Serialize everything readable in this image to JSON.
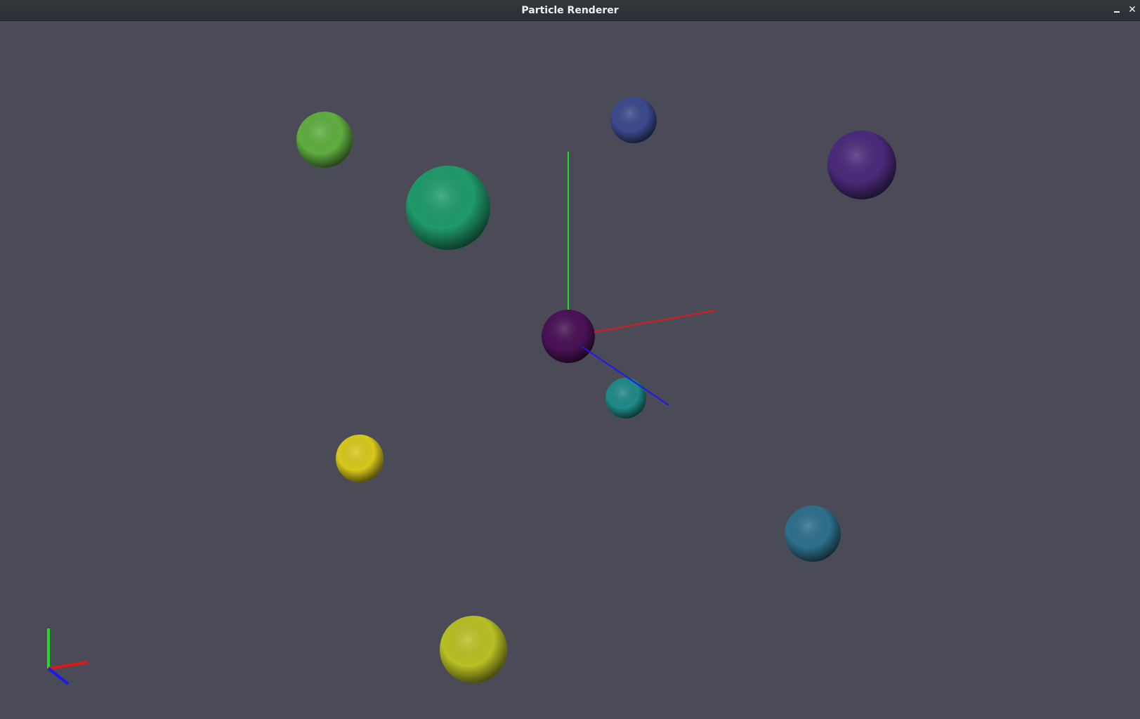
{
  "window": {
    "title": "Particle Renderer",
    "minimize_icon": "minimize-icon",
    "close_icon": "close-icon",
    "close_glyph": "✕"
  },
  "scene": {
    "background": "#4b4b57",
    "axis_colors": {
      "x": "#e01818",
      "y": "#22dd22",
      "z": "#1a1aee"
    },
    "particles": [
      {
        "name": "particle-green-light",
        "color": "#5fae40"
      },
      {
        "name": "particle-blue-small",
        "color": "#3a4a8c"
      },
      {
        "name": "particle-teal-large",
        "color": "#1f9a6a"
      },
      {
        "name": "particle-purple-right",
        "color": "#4b2a7a"
      },
      {
        "name": "particle-purple-center",
        "color": "#4a1256"
      },
      {
        "name": "particle-teal-small",
        "color": "#1f8a88"
      },
      {
        "name": "particle-yellow",
        "color": "#d8c81c"
      },
      {
        "name": "particle-steel-blue",
        "color": "#2e6f8c"
      },
      {
        "name": "particle-yellow-green",
        "color": "#b8c024"
      }
    ]
  }
}
